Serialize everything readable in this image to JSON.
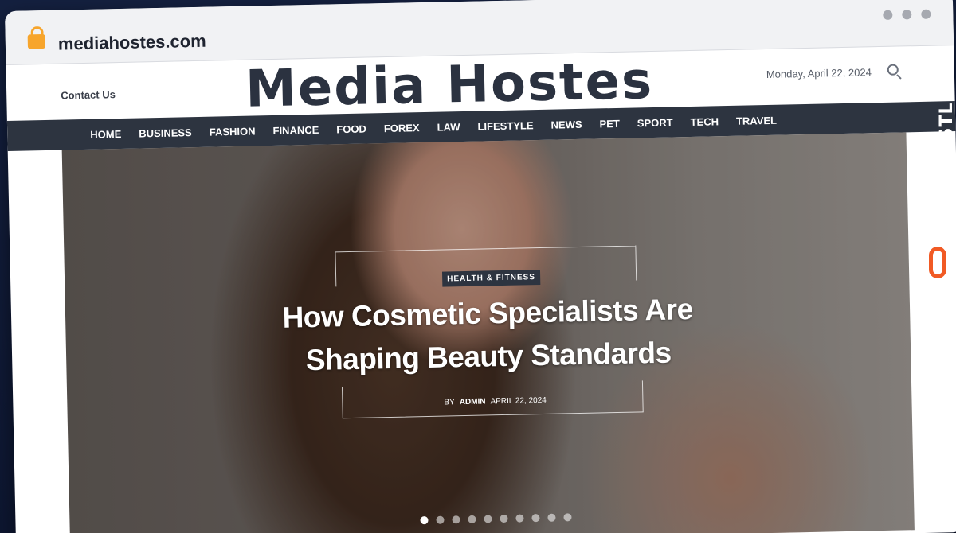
{
  "browser": {
    "url": "mediahostes.com"
  },
  "header": {
    "contact_label": "Contact Us",
    "logo_text": "Media Hostes",
    "date": "Monday, April 22, 2024"
  },
  "nav": {
    "items": [
      "HOME",
      "BUSINESS",
      "FASHION",
      "FINANCE",
      "FOOD",
      "FOREX",
      "LAW",
      "LIFESTYLE",
      "NEWS",
      "PET",
      "SPORT",
      "TECH",
      "TRAVEL"
    ]
  },
  "hero": {
    "category": "HEALTH & FITNESS",
    "title": "How Cosmetic Specialists Are Shaping Beauty Standards",
    "by_label": "BY",
    "author": "ADMIN",
    "date": "APRIL 22, 2024",
    "slide_count": 10,
    "active_slide": 1
  },
  "watermark": {
    "text": "GUESTPOSTLINKS",
    "icon": "link-icon"
  },
  "colors": {
    "nav_bg": "#2d3440",
    "lock": "#f7a52c",
    "watermark_accent": "#f15a24"
  }
}
